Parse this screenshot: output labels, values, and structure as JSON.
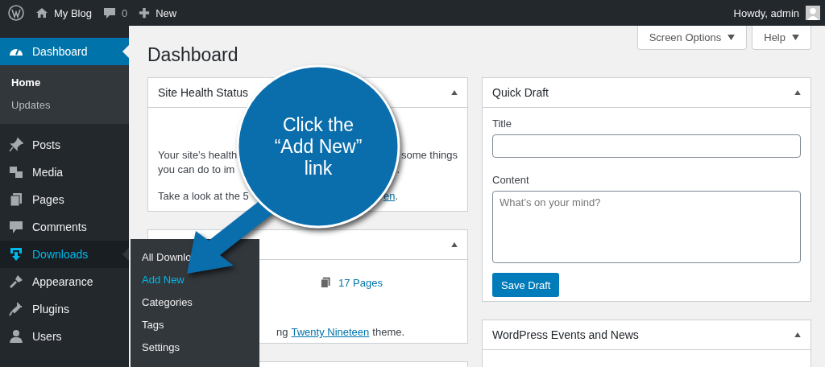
{
  "admin_bar": {
    "site": "My Blog",
    "comments": "0",
    "new": "New",
    "greeting": "Howdy, admin"
  },
  "sidebar": {
    "items": [
      {
        "label": "Dashboard",
        "selected": true,
        "open": false,
        "children": [
          {
            "label": "Home",
            "selected": true
          },
          {
            "label": "Updates",
            "selected": false
          }
        ]
      },
      {
        "label": "Posts",
        "selected": false,
        "open": false
      },
      {
        "label": "Media",
        "selected": false,
        "open": false
      },
      {
        "label": "Pages",
        "selected": false,
        "open": false
      },
      {
        "label": "Comments",
        "selected": false,
        "open": false
      },
      {
        "label": "Downloads",
        "selected": false,
        "open": true
      },
      {
        "label": "Appearance",
        "selected": false,
        "open": false
      },
      {
        "label": "Plugins",
        "selected": false,
        "open": false
      },
      {
        "label": "Users",
        "selected": false,
        "open": false
      }
    ]
  },
  "flyout": {
    "items": [
      {
        "label": "All Downlo",
        "selected": false
      },
      {
        "label": "Add New",
        "selected": true
      },
      {
        "label": "Categories",
        "selected": false
      },
      {
        "label": "Tags",
        "selected": false
      },
      {
        "label": "Settings",
        "selected": false
      }
    ]
  },
  "page": {
    "title": "Dashboard",
    "screen_options": "Screen Options",
    "help": "Help"
  },
  "site_health": {
    "title": "Site Health Status",
    "lines": [
      {
        "left": "Your site’s health",
        "right": "some things"
      },
      {
        "left": "you can do to im",
        "right": "."
      },
      {
        "left": "Take a look at the 5",
        "link": "en",
        "right": "."
      }
    ]
  },
  "at_a_glance": {
    "pages": "17 Pages",
    "theme_prefix": "ng",
    "theme_link": "Twenty Nineteen",
    "theme_suffix": "theme."
  },
  "quick_draft": {
    "title": "Quick Draft",
    "title_label": "Title",
    "content_label": "Content",
    "content_placeholder": "What’s on your mind?",
    "button": "Save Draft"
  },
  "events": {
    "title": "WordPress Events and News"
  },
  "callout": {
    "text": "Click the\n“Add New”\nlink"
  }
}
